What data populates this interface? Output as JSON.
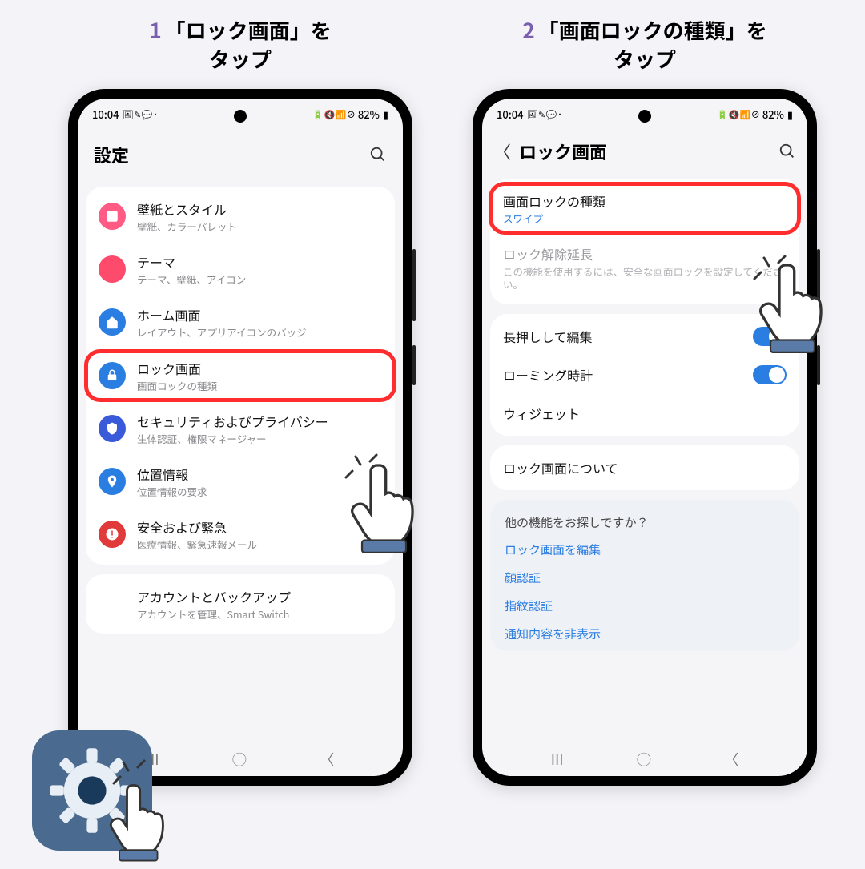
{
  "steps": [
    {
      "num": "1",
      "title_l1": "「ロック画面」を",
      "title_l2": "タップ"
    },
    {
      "num": "2",
      "title_l1": "「画面ロックの種類」を",
      "title_l2": "タップ"
    }
  ],
  "statusbar": {
    "time": "10:04",
    "battery_text": "82%"
  },
  "screen1": {
    "header_title": "設定",
    "rows": [
      {
        "icon_bg": "#ff5b84",
        "icon": "image",
        "title": "壁紙とスタイル",
        "sub": "壁紙、カラーパレット"
      },
      {
        "icon_bg": "#ff4b6b",
        "icon": "palette",
        "title": "テーマ",
        "sub": "テーマ、壁紙、アイコン"
      },
      {
        "icon_bg": "#2a7de1",
        "icon": "home",
        "title": "ホーム画面",
        "sub": "レイアウト、アプリアイコンのバッジ"
      },
      {
        "icon_bg": "#2a7de1",
        "icon": "lock",
        "title": "ロック画面",
        "sub": "画面ロックの種類",
        "highlight": true
      },
      {
        "icon_bg": "#3a5bd9",
        "icon": "shield",
        "title": "セキュリティおよびプライバシー",
        "sub": "生体認証、権限マネージャー"
      },
      {
        "icon_bg": "#2a7de1",
        "icon": "pin",
        "title": "位置情報",
        "sub": "位置情報の要求"
      },
      {
        "icon_bg": "#e03a3a",
        "icon": "alert",
        "title": "安全および緊急",
        "sub": "医療情報、緊急速報メール"
      },
      {
        "icon_bg": "#888",
        "icon": "cloud",
        "title": "アカウントとバックアップ",
        "sub": "アカウントを管理、Smart Switch",
        "truncated": true
      }
    ]
  },
  "screen2": {
    "header_title": "ロック画面",
    "lock_type": {
      "title": "画面ロックの種類",
      "sub": "スワイプ",
      "highlight": true
    },
    "extend_unlock": {
      "title": "ロック解除延長",
      "sub": "この機能を使用するには、安全な画面ロックを設定してください。"
    },
    "longpress_edit": {
      "title": "長押しして編集",
      "on": true
    },
    "roaming_clock": {
      "title": "ローミング時計",
      "on": true
    },
    "widgets": {
      "title": "ウィジェット"
    },
    "about": {
      "title": "ロック画面について"
    },
    "looking_for": {
      "heading": "他の機能をお探しですか？",
      "links": [
        "ロック画面を編集",
        "顔認証",
        "指紋認証",
        "通知内容を非表示"
      ]
    }
  }
}
